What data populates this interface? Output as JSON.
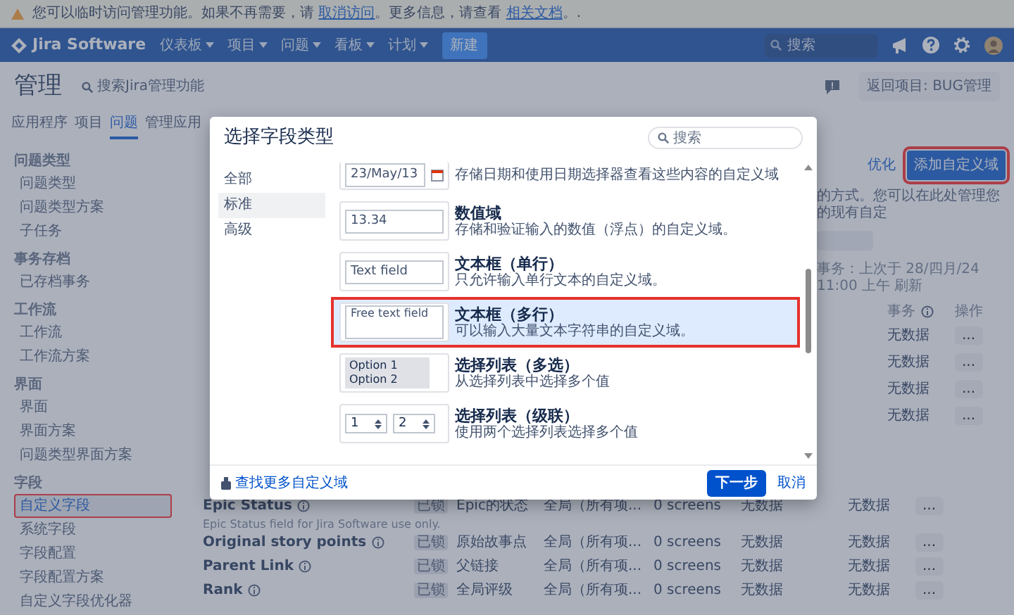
{
  "banner": {
    "parts": [
      {
        "kind": "text",
        "text": "您可以临时访问管理功能。如果不再需要，请 "
      },
      {
        "kind": "link",
        "text": "取消访问"
      },
      {
        "kind": "text",
        "text": "。更多信息，请查看 "
      },
      {
        "kind": "link",
        "text": "相关文档"
      },
      {
        "kind": "text",
        "text": "。."
      }
    ]
  },
  "navbar": {
    "product": "Jira Software",
    "menus": [
      {
        "label": "仪表板"
      },
      {
        "label": "项目"
      },
      {
        "label": "问题"
      },
      {
        "label": "看板"
      },
      {
        "label": "计划"
      }
    ],
    "create_button": "新建",
    "search_placeholder": "搜索"
  },
  "header": {
    "title": "管理",
    "search_label": "搜索Jira管理功能",
    "back_button": "返回项目: BUG管理"
  },
  "tabs": [
    {
      "label": "应用程序",
      "selected": false
    },
    {
      "label": "项目",
      "selected": false
    },
    {
      "label": "问题",
      "selected": true
    },
    {
      "label": "管理应用",
      "selected": false
    }
  ],
  "sidebar": {
    "sections": [
      {
        "heading": "问题类型",
        "items": [
          {
            "label": "问题类型",
            "selected": false,
            "annotated": false
          },
          {
            "label": "问题类型方案",
            "selected": false,
            "annotated": false
          },
          {
            "label": "子任务",
            "selected": false,
            "annotated": false
          }
        ]
      },
      {
        "heading": "事务存档",
        "items": [
          {
            "label": "已存档事务",
            "selected": false,
            "annotated": false
          }
        ]
      },
      {
        "heading": "工作流",
        "items": [
          {
            "label": "工作流",
            "selected": false,
            "annotated": false
          },
          {
            "label": "工作流方案",
            "selected": false,
            "annotated": false
          }
        ]
      },
      {
        "heading": "界面",
        "items": [
          {
            "label": "界面",
            "selected": false,
            "annotated": false
          },
          {
            "label": "界面方案",
            "selected": false,
            "annotated": false
          },
          {
            "label": "问题类型界面方案",
            "selected": false,
            "annotated": false
          }
        ]
      },
      {
        "heading": "字段",
        "items": [
          {
            "label": "自定义字段",
            "selected": true,
            "annotated": true
          },
          {
            "label": "系统字段",
            "selected": false,
            "annotated": false
          },
          {
            "label": "字段配置",
            "selected": false,
            "annotated": false
          },
          {
            "label": "字段配置方案",
            "selected": false,
            "annotated": false
          },
          {
            "label": "自定义字段优化器",
            "selected": false,
            "annotated": false
          }
        ]
      }
    ]
  },
  "main": {
    "optimize_link": "优化",
    "add_button": {
      "label": "添加自定义域",
      "annotated": true
    },
    "description": "的方式。您可以在此处管理您的现有自定",
    "refresh_note": "事务：上次于 28/四月/24 11:00 上午 刷新",
    "columns": [
      "事务",
      "操作"
    ],
    "upper_rows": [
      {
        "events": "无数据",
        "action": "..."
      },
      {
        "events": "无数据",
        "action": "..."
      },
      {
        "events": "无数据",
        "action": "..."
      },
      {
        "events": "无数据",
        "action": "..."
      }
    ],
    "rows": [
      {
        "name": "Epic Status",
        "tag": "已锁",
        "description": "Epic Status field for Jira Software use only.",
        "type": "Epic的状态",
        "context": "全局（所有项...",
        "screens": "0 screens",
        "last_value": "无数据",
        "events": "无数据",
        "action": "..."
      },
      {
        "name": "Original story points",
        "tag": "已锁",
        "type": "原始故事点",
        "context": "全局（所有项...",
        "screens": "0 screens",
        "last_value": "无数据",
        "events": "无数据",
        "action": "..."
      },
      {
        "name": "Parent Link",
        "tag": "已锁",
        "type": "父链接",
        "context": "全局（所有项...",
        "screens": "0 screens",
        "last_value": "无数据",
        "events": "无数据",
        "action": "..."
      },
      {
        "name": "Rank",
        "tag": "已锁",
        "type": "全局评级",
        "context": "全局（所有项...",
        "screens": "0 screens",
        "last_value": "无数据",
        "events": "无数据",
        "action": "..."
      }
    ]
  },
  "modal": {
    "title": "选择字段类型",
    "search_placeholder": "搜索",
    "categories": [
      {
        "label": "全部",
        "selected": false
      },
      {
        "label": "标准",
        "selected": true
      },
      {
        "label": "高级",
        "selected": false
      }
    ],
    "field_types": [
      {
        "kind": "date",
        "preview": "23/May/13",
        "description": "存储日期和使用日期选择器查看这些内容的自定义域",
        "selected": false,
        "annotated": false
      },
      {
        "kind": "input",
        "name": "数值域",
        "preview": "13.34",
        "description": "存储和验证输入的数值（浮点）的自定义域。",
        "selected": false,
        "annotated": false
      },
      {
        "kind": "input",
        "name": "文本框（单行）",
        "preview": "Text field",
        "description": "只允许输入单行文本的自定义域。",
        "selected": false,
        "annotated": false
      },
      {
        "kind": "textarea",
        "name": "文本框（多行）",
        "preview": "Free text field",
        "description": "可以输入大量文本字符串的自定义域。",
        "selected": true,
        "annotated": true
      },
      {
        "kind": "multiselect",
        "name": "选择列表（多选）",
        "options": [
          "Option 1",
          "Option 2"
        ],
        "description": "从选择列表中选择多个值",
        "selected": false,
        "annotated": false
      },
      {
        "kind": "cascade",
        "name": "选择列表（级联）",
        "options": [
          "1",
          "2"
        ],
        "description": "使用两个选择列表选择多个值",
        "selected": false,
        "annotated": false
      }
    ],
    "more_link": "查找更多自定义域",
    "next_button": "下一步",
    "cancel_link": "取消"
  }
}
